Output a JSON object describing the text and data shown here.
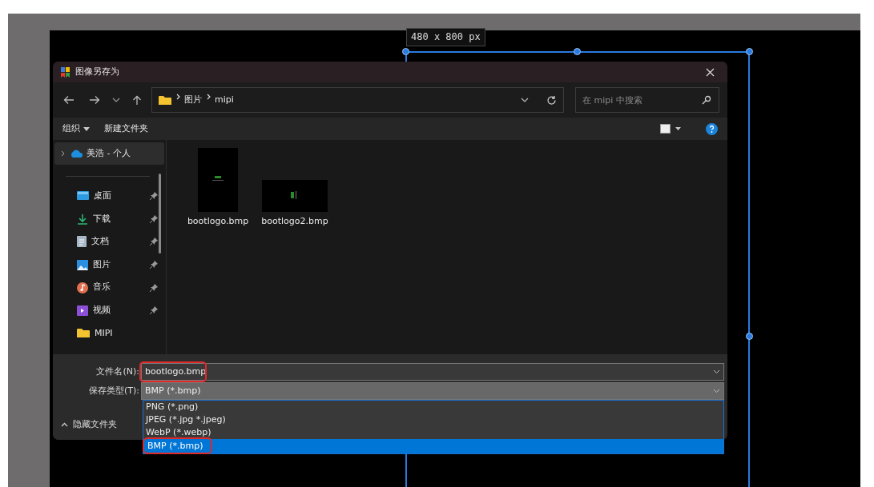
{
  "canvas": {
    "size_label": "480 x 800 px"
  },
  "dialog": {
    "title": "图像另存为",
    "nav": {
      "path": [
        "图片",
        "mipi"
      ],
      "search_placeholder": "在 mipi 中搜索"
    },
    "toolbar": {
      "organize": "组织",
      "new_folder": "新建文件夹"
    },
    "sidebar": {
      "cloud": {
        "label": "美浩 - 个人",
        "expanded": false,
        "selected": true
      },
      "items": [
        {
          "label": "桌面",
          "kind": "desktop",
          "pinned": true,
          "selected": false
        },
        {
          "label": "下载",
          "kind": "download",
          "pinned": true,
          "selected": false
        },
        {
          "label": "文档",
          "kind": "document",
          "pinned": true,
          "selected": false
        },
        {
          "label": "图片",
          "kind": "pictures",
          "pinned": true,
          "selected": false
        },
        {
          "label": "音乐",
          "kind": "music",
          "pinned": true,
          "selected": false
        },
        {
          "label": "视频",
          "kind": "video",
          "pinned": true,
          "selected": false
        },
        {
          "label": "MIPI",
          "kind": "folder",
          "pinned": false,
          "selected": false
        }
      ]
    },
    "files": [
      {
        "name": "bootlogo.bmp",
        "kind": "portrait"
      },
      {
        "name": "bootlogo2.bmp",
        "kind": "landscape"
      }
    ],
    "filename": {
      "label": "文件名(N):",
      "value": "bootlogo.bmp",
      "highlighted": true
    },
    "filetype": {
      "label": "保存类型(T):",
      "value": "BMP (*.bmp)"
    },
    "filetype_options": [
      {
        "label": "PNG (*.png)",
        "selected": false,
        "highlighted": false
      },
      {
        "label": "JPEG (*.jpg *.jpeg)",
        "selected": false,
        "highlighted": false
      },
      {
        "label": "WebP (*.webp)",
        "selected": false,
        "highlighted": false
      },
      {
        "label": "BMP (*.bmp)",
        "selected": true,
        "highlighted": true
      }
    ],
    "hide_folders": "隐藏文件夹"
  }
}
